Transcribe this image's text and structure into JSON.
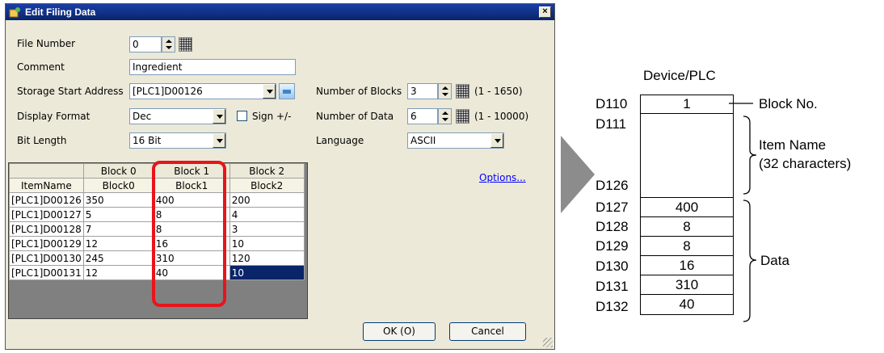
{
  "dialog": {
    "title": "Edit Filing Data",
    "close_label": "×",
    "file_number": {
      "label": "File Number",
      "value": "0"
    },
    "comment": {
      "label": "Comment",
      "value": "Ingredient"
    },
    "storage_start_address": {
      "label": "Storage Start Address",
      "value": "[PLC1]D00126"
    },
    "display_format": {
      "label": "Display Format",
      "value": "Dec"
    },
    "sign": {
      "label": "Sign +/-",
      "checked": false
    },
    "bit_length": {
      "label": "Bit Length",
      "value": "16 Bit"
    },
    "number_of_blocks": {
      "label": "Number of Blocks",
      "value": "3",
      "range": "(1 - 1650)"
    },
    "number_of_data": {
      "label": "Number of Data",
      "value": "6",
      "range": "(1 - 10000)"
    },
    "language": {
      "label": "Language",
      "value": "ASCII"
    },
    "options_link": "Options...",
    "table": {
      "block_headers": [
        "Block 0",
        "Block 1",
        "Block 2"
      ],
      "item_name_header": "ItemName",
      "item_names": [
        "Block0",
        "Block1",
        "Block2"
      ],
      "rows": [
        {
          "address": "[PLC1]D00126",
          "values": [
            "350",
            "400",
            "200"
          ]
        },
        {
          "address": "[PLC1]D00127",
          "values": [
            "5",
            "8",
            "4"
          ]
        },
        {
          "address": "[PLC1]D00128",
          "values": [
            "7",
            "8",
            "3"
          ]
        },
        {
          "address": "[PLC1]D00129",
          "values": [
            "12",
            "16",
            "10"
          ]
        },
        {
          "address": "[PLC1]D00130",
          "values": [
            "245",
            "310",
            "120"
          ]
        },
        {
          "address": "[PLC1]D00131",
          "values": [
            "12",
            "40",
            "10"
          ]
        }
      ]
    },
    "ok_label": "OK (O)",
    "cancel_label": "Cancel"
  },
  "memory_map": {
    "title": "Device/PLC",
    "addresses": [
      "D110",
      "D111",
      "D126",
      "D127",
      "D128",
      "D129",
      "D130",
      "D131",
      "D132"
    ],
    "block_no_value": "1",
    "data_values": [
      "400",
      "8",
      "8",
      "16",
      "310",
      "40"
    ],
    "block_no_label": "Block No.",
    "item_name_label": "Item Name",
    "item_name_sub": "(32 characters)",
    "data_label": "Data"
  }
}
